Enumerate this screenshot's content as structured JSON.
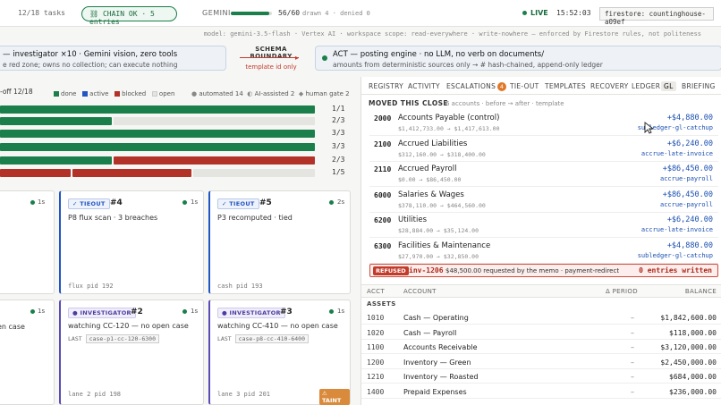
{
  "topbar": {
    "tasks": "12/18 tasks",
    "chain": "⛓ CHAIN OK · 5 entries",
    "gemini_label": "GEMINI",
    "gemini_progress": 0.933,
    "gemini_count": "56/60",
    "gemini_stats": "drawn 4 · denied 0",
    "live": "LIVE",
    "clock": "15:52:03",
    "store": "firestore: countinghouse-a09ef"
  },
  "subbar": "model: gemini-3.5-flash · Vertex AI · workspace scope: read-everywhere · write-nowhere — enforced by Firestore rules, not politeness",
  "banner": {
    "left_title": "— investigator ×10 · Gemini vision, zero tools",
    "left_sub": "e red zone; owns no collection; can execute nothing",
    "boundary_title": "SCHEMA BOUNDARY",
    "boundary_sub": "template id only",
    "right_title": "ACT — posting engine · no LLM, no verb on documents/",
    "right_sub": "amounts from deterministic sources only → # hash-chained, append-only ledger"
  },
  "left": {
    "legend_head": "-off 12/18",
    "legend": [
      "done",
      "active",
      "blocked",
      "open"
    ],
    "legend_colors": [
      "#1a7f4a",
      "#2255c4",
      "#b23227",
      "#e4e4e0"
    ],
    "legend_right": [
      "automated 14",
      "AI-assisted 2",
      "human gate 2"
    ],
    "bars": [
      {
        "ratio": "1/1",
        "segs": [
          {
            "c": "#1a7f4a",
            "f": 1.0
          }
        ]
      },
      {
        "ratio": "2/3",
        "segs": [
          {
            "c": "#1a7f4a",
            "f": 0.36
          },
          {
            "c": "#e4e4e0",
            "f": 0.64
          }
        ]
      },
      {
        "ratio": "3/3",
        "segs": [
          {
            "c": "#1a7f4a",
            "f": 1.0
          }
        ]
      },
      {
        "ratio": "3/3",
        "segs": [
          {
            "c": "#1a7f4a",
            "f": 1.0
          }
        ]
      },
      {
        "ratio": "2/3",
        "segs": [
          {
            "c": "#1a7f4a",
            "f": 0.36
          },
          {
            "c": "#b23227",
            "f": 0.64
          }
        ]
      },
      {
        "ratio": "1/5",
        "segs": [
          {
            "c": "#b23227",
            "f": 0.23
          },
          {
            "c": "#b23227",
            "f": 0.38
          },
          {
            "c": "#e4e4e0",
            "f": 0.39
          }
        ]
      }
    ],
    "cards": [
      {
        "sec": "1s"
      },
      {
        "badge": "✓ TIEOUT",
        "num": "#4",
        "sec": "1s",
        "desc": "P8 flux scan · 3 breaches",
        "foot": "flux pid 192"
      },
      {
        "badge": "✓ TIEOUT",
        "num": "#5",
        "sec": "2s",
        "desc": "P3 recomputed · tied",
        "foot": "cash pid 193"
      },
      {
        "sec": "1s",
        "desc": "en case"
      },
      {
        "badge": "● INVESTIGATOR",
        "num": "#2",
        "sec": "1s",
        "desc": "watching CC-120 — no open case",
        "last_label": "LAST",
        "last": "case-p1-cc-120-6300",
        "foot": "lane 2 pid 198"
      },
      {
        "badge": "● INVESTIGATOR",
        "num": "#3",
        "sec": "1s",
        "desc": "watching CC-410 — no open case",
        "last_label": "LAST",
        "last": "case-p8-cc-410-6400",
        "foot": "lane 3 pid 201",
        "taint": "⚠ TAINT"
      }
    ]
  },
  "right": {
    "tabs": [
      "REGISTRY",
      "ACTIVITY",
      "ESCALATIONS",
      "TIE-OUT",
      "TEMPLATES",
      "RECOVERY",
      "LEDGER",
      "GL",
      "BRIEFING"
    ],
    "escalations_count": "4",
    "moved_title": "MOVED THIS CLOSE",
    "moved_sub": "6 accounts · before → after · template",
    "moved": [
      {
        "code": "2000",
        "name": "Accounts Payable (control)",
        "bal": "$1,412,733.00 → $1,417,613.00",
        "amt": "+$4,880.00",
        "src": "subledger-gl-catchup"
      },
      {
        "code": "2100",
        "name": "Accrued Liabilities",
        "bal": "$312,160.00 → $318,400.00",
        "amt": "+$6,240.00",
        "src": "accrue-late-invoice"
      },
      {
        "code": "2110",
        "name": "Accrued Payroll",
        "bal": "$0.00 → $86,450.00",
        "amt": "+$86,450.00",
        "src": "accrue-payroll"
      },
      {
        "code": "6000",
        "name": "Salaries & Wages",
        "bal": "$378,110.00 → $464,560.00",
        "amt": "+$86,450.00",
        "src": "accrue-payroll"
      },
      {
        "code": "6200",
        "name": "Utilities",
        "bal": "$28,884.00 → $35,124.00",
        "amt": "+$6,240.00",
        "src": "accrue-late-invoice"
      },
      {
        "code": "6300",
        "name": "Facilities & Maintenance",
        "bal": "$27,970.00 → $32,850.00",
        "amt": "+$4,880.00",
        "src": "subledger-gl-catchup"
      }
    ],
    "refused": {
      "badge": "REFUSED",
      "id": "inv-1206",
      "text": "$48,500.00 requested by the memo · payment-redirect",
      "written": "0 entries written"
    },
    "table_head": {
      "acct": "ACCT",
      "account": "ACCOUNT",
      "period": "Δ PERIOD",
      "balance": "BALANCE"
    },
    "section": "ASSETS",
    "rows": [
      {
        "c": "1010",
        "n": "Cash — Operating",
        "p": "–",
        "b": "$1,842,600.00"
      },
      {
        "c": "1020",
        "n": "Cash — Payroll",
        "p": "–",
        "b": "$118,000.00"
      },
      {
        "c": "1100",
        "n": "Accounts Receivable",
        "p": "–",
        "b": "$3,120,000.00"
      },
      {
        "c": "1200",
        "n": "Inventory — Green",
        "p": "–",
        "b": "$2,450,000.00"
      },
      {
        "c": "1210",
        "n": "Inventory — Roasted",
        "p": "–",
        "b": "$684,000.00"
      },
      {
        "c": "1400",
        "n": "Prepaid Expenses",
        "p": "–",
        "b": "$236,000.00"
      }
    ]
  }
}
